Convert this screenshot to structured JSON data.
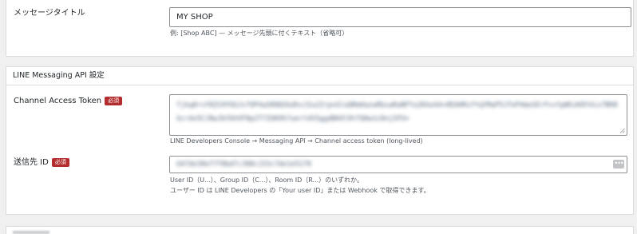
{
  "message_title": {
    "label": "メッセージタイトル",
    "value": "MY SHOP",
    "description": "例: [Shop ABC] — メッセージ先頭に付くテキスト（省略可）"
  },
  "line_section": {
    "heading": "LINE Messaging API 設定",
    "access_token": {
      "label": "Channel Access Token",
      "badge": "必須",
      "value": "fjkq8rvY8ZCHYOGJv7OP4aSR8QSkdhvJ2u2ZrpvGloQRm0azwRbsaRaNFYu2Kke44+0EAHRsYYqYMaP5JfeP4meSErFvvYpWhzK8Y4ix7BH8Gcrdx5CJ8wJbYbhVF8p2T7ZUK9h7uert4S5ggdB04l8tfQ0w1cDnjSFU=",
      "description": "LINE Developers Console → Messaging API → Channel access token (long-lived)"
    },
    "recipient_id": {
      "label": "送信先 ID",
      "badge": "必須",
      "value": "U47de38ef7f8bd7c388c153c7de1e5178",
      "description_line1": "User ID（U...）、Group ID（C...）、Room ID（R...）のいずれか。",
      "description_line2": "ユーザー ID は LINE Developers の「Your user ID」または Webhook で取得できます。"
    }
  },
  "colors": {
    "required_badge": "#b32d2e",
    "page_background": "#f0f0f1"
  },
  "icons": {
    "dots_button": "ellipsis-icon",
    "resize_handle": "resize-grip-icon"
  }
}
